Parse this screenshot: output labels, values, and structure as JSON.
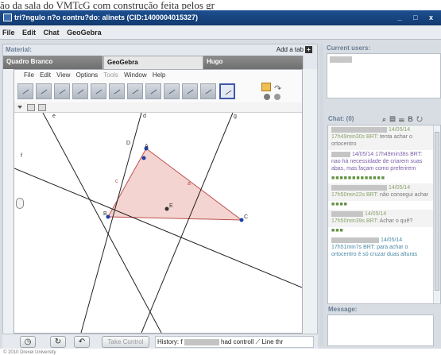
{
  "caption": "ão da sala do VMTcG com construção feita pelos gr",
  "window": {
    "title": "tri?ngulo n?o contru?do: alinets (CID:1400004015327)",
    "controls": "_ □ x"
  },
  "menubar": [
    "File",
    "Edit",
    "Chat",
    "GeoGebra"
  ],
  "material": {
    "header": "Material:",
    "add_tab": "Add a tab",
    "add_tab_icon": "plus-icon",
    "tabs": [
      {
        "label": "Quadro Branco",
        "active": false
      },
      {
        "label": "GeoGebra",
        "active": true
      },
      {
        "label": "Hugo",
        "active": false
      }
    ]
  },
  "geogebra": {
    "menu": [
      {
        "label": "File",
        "disabled": false
      },
      {
        "label": "Edit",
        "disabled": false
      },
      {
        "label": "View",
        "disabled": false
      },
      {
        "label": "Options",
        "disabled": false
      },
      {
        "label": "Tools",
        "disabled": true
      },
      {
        "label": "Window",
        "disabled": false
      },
      {
        "label": "Help",
        "disabled": false
      }
    ],
    "points": [
      "A",
      "B",
      "C",
      "D",
      "E"
    ],
    "lines": [
      "e",
      "d",
      "g",
      "f",
      "c",
      "a"
    ]
  },
  "bottombar": {
    "take_control": "Take Control",
    "history_label": "History: f",
    "history_suffix": "had controll",
    "line_tool": "Line thr"
  },
  "copyright": "© 2010 Drexel University",
  "current_users": {
    "header": "Current users:",
    "user_blurred": "alinets"
  },
  "chat": {
    "header": "Chat: (0)",
    "messages": [
      {
        "name_blurred": true,
        "date": "14/05/14",
        "time": "17h49min30s BRT:",
        "text": "tenta achar o ortocentro",
        "color": "green"
      },
      {
        "name_blurred": true,
        "date": "14/05/14",
        "time": "17h49min38s BRT:",
        "text": "nao há necessidade de criarem suas abas, mas façam como preferirem",
        "color": "purple"
      },
      {
        "dots": "■■■■■■■■■■■■■"
      },
      {
        "name_blurred": true,
        "date": "14/05/14",
        "time": "17h50min22s BRT:",
        "text": "não consegui achar",
        "color": "green"
      },
      {
        "dots": "■■■■"
      },
      {
        "name_blurred": true,
        "date": "14/05/14",
        "time": "17h50min39s BRT:",
        "text": "Achar o quê?",
        "color": "green"
      },
      {
        "dots": "■■■"
      },
      {
        "name_blurred": true,
        "date": "14/05/14",
        "time": "17h51min7s BRT:",
        "text": "para achar o ortocentro é só cruzar duas alturas",
        "color": "teal"
      }
    ]
  },
  "message": {
    "header": "Message:"
  }
}
